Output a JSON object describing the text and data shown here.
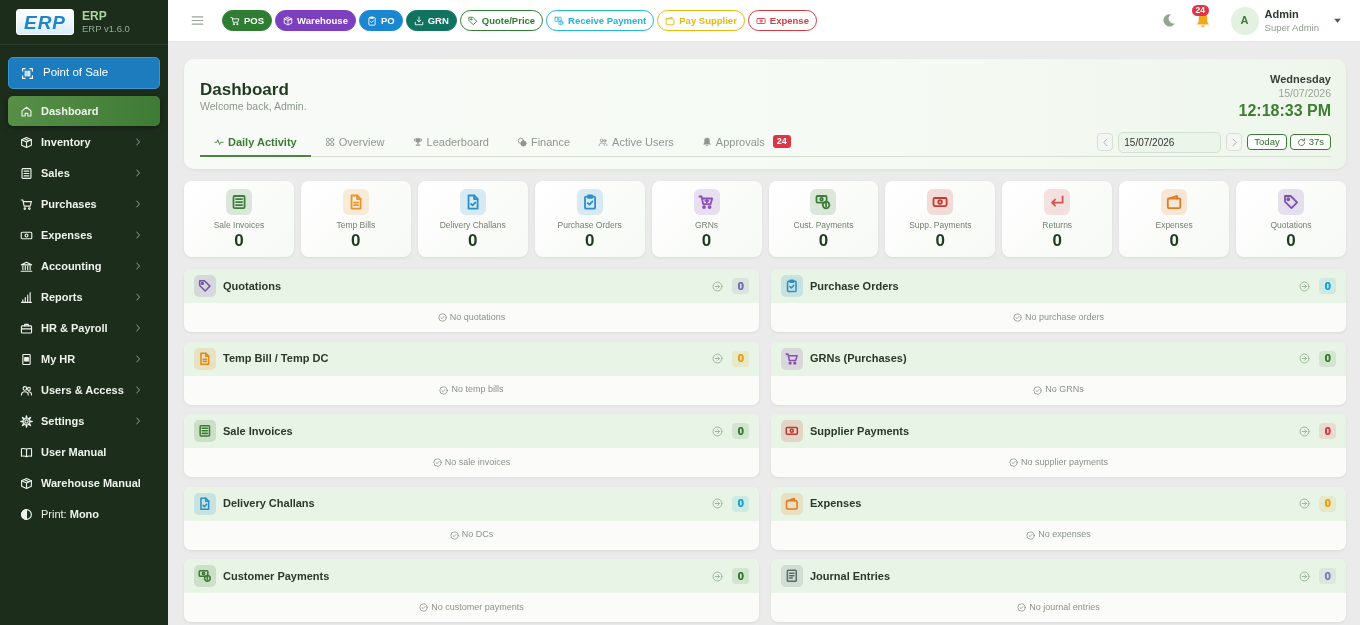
{
  "sidebar": {
    "logo": "ERP",
    "app_name": "ERP",
    "version": "ERP v1.6.0",
    "pos_button": "Point of Sale",
    "items": [
      {
        "label": "Dashboard",
        "kind": "link",
        "selected": true
      },
      {
        "label": "Inventory",
        "kind": "group",
        "selected": false
      },
      {
        "label": "Sales",
        "kind": "group",
        "selected": false
      },
      {
        "label": "Purchases",
        "kind": "group",
        "selected": false
      },
      {
        "label": "Expenses",
        "kind": "group",
        "selected": false
      },
      {
        "label": "Accounting",
        "kind": "group",
        "selected": false
      },
      {
        "label": "Reports",
        "kind": "group",
        "selected": false
      },
      {
        "label": "HR & Payroll",
        "kind": "group",
        "selected": false
      },
      {
        "label": "My HR",
        "kind": "group",
        "selected": false
      },
      {
        "label": "Users & Access",
        "kind": "group",
        "selected": false
      },
      {
        "label": "Settings",
        "kind": "group",
        "selected": false
      },
      {
        "label": "User Manual",
        "kind": "link",
        "selected": false
      },
      {
        "label": "Warehouse Manual",
        "kind": "link",
        "selected": false
      }
    ],
    "print_mode": "Print: **Mono**"
  },
  "topbar": {
    "quick_actions": [
      {
        "label": "POS",
        "kind": "filled",
        "color": "#2e7d32"
      },
      {
        "label": "Warehouse",
        "kind": "filled",
        "color": "#7b3fbf"
      },
      {
        "label": "PO",
        "kind": "filled",
        "color": "#1b86d1"
      },
      {
        "label": "GRN",
        "kind": "filled",
        "color": "#10735f"
      },
      {
        "label": "Quote/Price",
        "kind": "outline",
        "color": "#2e7d32"
      },
      {
        "label": "Receive Payment",
        "kind": "outline",
        "color": "#20b6d6"
      },
      {
        "label": "Pay Supplier",
        "kind": "outline",
        "color": "#e8b70a"
      },
      {
        "label": "Expense",
        "kind": "outline",
        "color": "#d63a3f"
      }
    ],
    "notifications": "24",
    "user": {
      "initial": "A",
      "name": "Admin",
      "role": "Super Admin"
    }
  },
  "header": {
    "title": "Dashboard",
    "subtitle": "Welcome back, Admin.",
    "day": "Wednesday",
    "date": "15/07/2026",
    "time": "12:18:33 PM",
    "tabs": [
      {
        "label": "Daily Activity",
        "selected": true
      },
      {
        "label": "Overview",
        "selected": false
      },
      {
        "label": "Leaderboard",
        "selected": false
      },
      {
        "label": "Finance",
        "selected": false
      },
      {
        "label": "Active Users",
        "selected": false
      },
      {
        "label": "Approvals",
        "selected": false,
        "badge": "24"
      }
    ],
    "date_field": {
      "value": "15/07/2026"
    },
    "today_button": "Today",
    "refresh_button": "37s"
  },
  "stats": [
    {
      "label": "Sale Invoices",
      "value": "0",
      "color": "#3f7f3a"
    },
    {
      "label": "Temp Bills",
      "value": "0",
      "color": "#e8962c"
    },
    {
      "label": "Delivery Challans",
      "value": "0",
      "color": "#2b90c8"
    },
    {
      "label": "Purchase Orders",
      "value": "0",
      "color": "#2b90c8"
    },
    {
      "label": "GRNs",
      "value": "0",
      "color": "#8a4fb8"
    },
    {
      "label": "Cust. Payments",
      "value": "0",
      "color": "#3f7f3a"
    },
    {
      "label": "Supp. Payments",
      "value": "0",
      "color": "#c63a30"
    },
    {
      "label": "Returns",
      "value": "0",
      "color": "#d05555"
    },
    {
      "label": "Expenses",
      "value": "0",
      "color": "#e07d24"
    },
    {
      "label": "Quotations",
      "value": "0",
      "color": "#7b52ab"
    }
  ],
  "panels": [
    {
      "title": "Quotations",
      "count": {
        "text": "0",
        "color": "#7b6bb0"
      },
      "empty_text": "No quotations",
      "color": "#7b52ab"
    },
    {
      "title": "Purchase Orders",
      "count": {
        "text": "0",
        "color": "#17a2d8"
      },
      "empty_text": "No purchase orders",
      "color": "#2b8fc4"
    },
    {
      "title": "Temp Bill / Temp DC",
      "count": {
        "text": "0",
        "color": "#e5a00d"
      },
      "empty_text": "No temp bills",
      "color": "#e08a18"
    },
    {
      "title": "GRNs (Purchases)",
      "count": {
        "text": "0",
        "color": "#3d7a35"
      },
      "empty_text": "No GRNs",
      "color": "#8a4fb3"
    },
    {
      "title": "Sale Invoices",
      "count": {
        "text": "0",
        "color": "#3d7a35"
      },
      "empty_text": "No sale invoices",
      "color": "#3d7a35"
    },
    {
      "title": "Supplier Payments",
      "count": {
        "text": "0",
        "color": "#dc3545"
      },
      "empty_text": "No supplier payments",
      "color": "#c0392b"
    },
    {
      "title": "Delivery Challans",
      "count": {
        "text": "0",
        "color": "#17a2d8"
      },
      "empty_text": "No DCs",
      "color": "#2b8fc4"
    },
    {
      "title": "Expenses",
      "count": {
        "text": "0",
        "color": "#e5a00d"
      },
      "empty_text": "No expenses",
      "color": "#e07b20"
    },
    {
      "title": "Customer Payments",
      "count": {
        "text": "0",
        "color": "#3d7a35"
      },
      "empty_text": "No customer payments",
      "color": "#3d7a35"
    },
    {
      "title": "Journal Entries",
      "count": {
        "text": "0",
        "color": "#8080b0"
      },
      "empty_text": "No journal entries",
      "color": "#5a6b70"
    }
  ]
}
